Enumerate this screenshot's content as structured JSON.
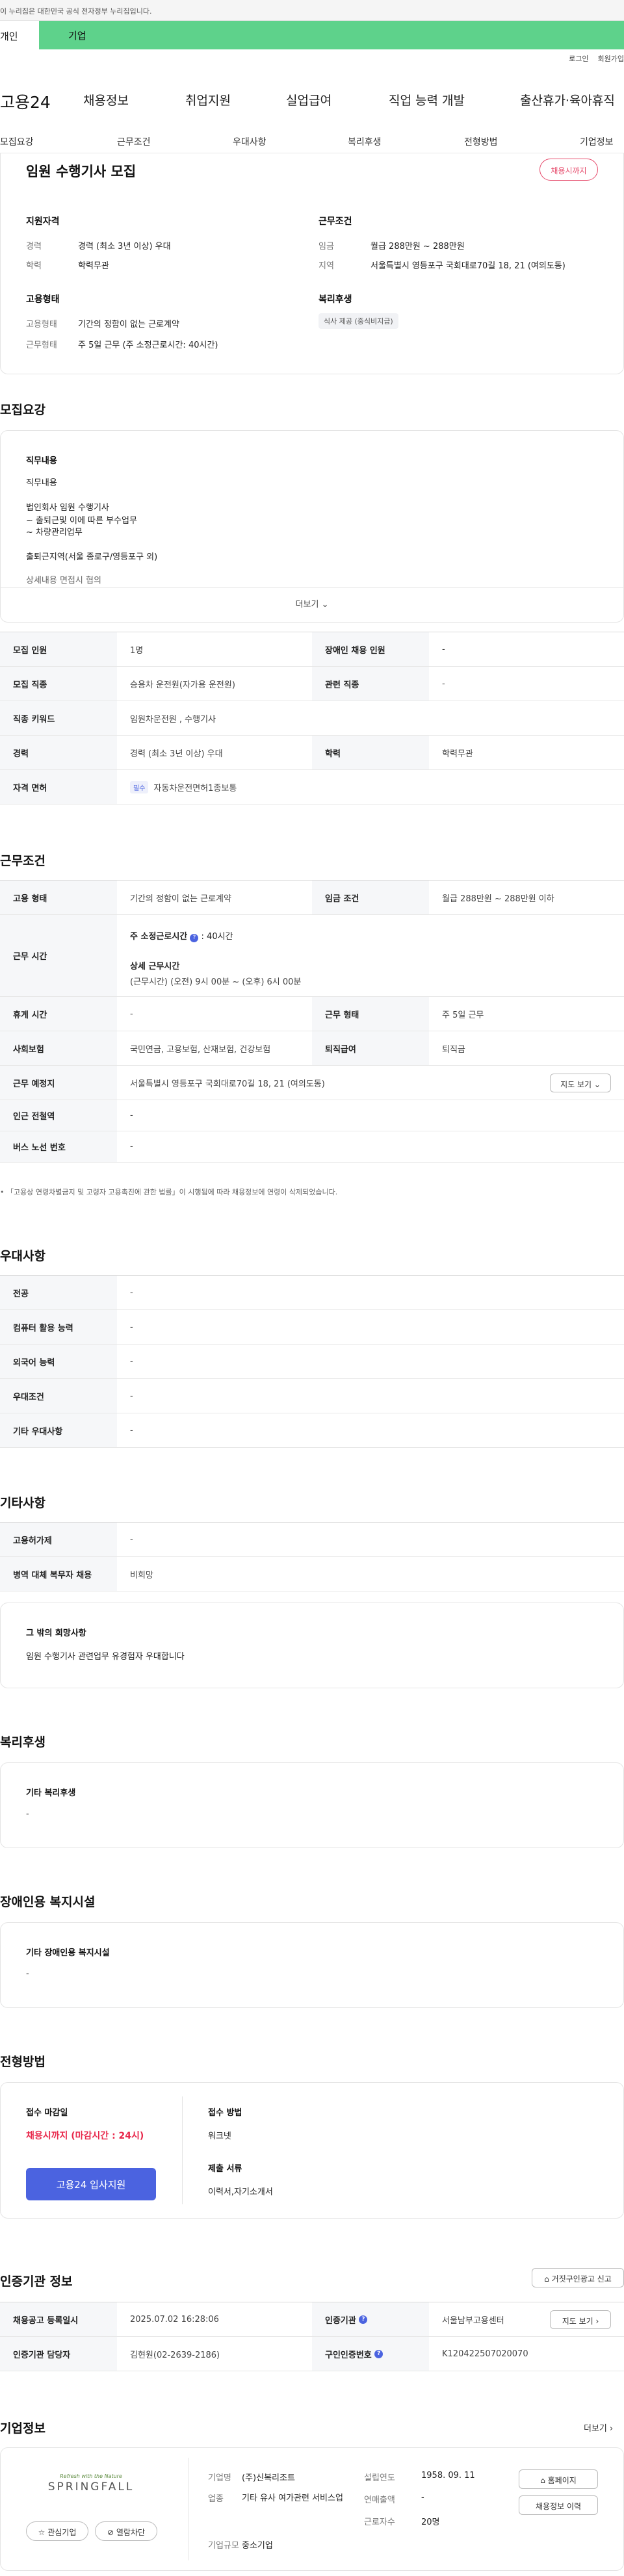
{
  "topbar": {
    "notice": "이 누리집은 대한민국 공식 전자정부 누리집입니다."
  },
  "mode": {
    "personal": "개인",
    "company": "기업"
  },
  "util": {
    "login": "로그인",
    "join": "회원가입"
  },
  "gnb": {
    "logo": "고용24",
    "items": [
      "채용정보",
      "취업지원",
      "실업급여",
      "직업 능력 개발",
      "출산휴가·육아휴직"
    ]
  },
  "subnav": [
    "모집요강",
    "근무조건",
    "우대사항",
    "복리후생",
    "전형방법",
    "기업정보"
  ],
  "job": {
    "title": "임원 수행기사 모집",
    "badge": "채용시까지"
  },
  "summary": {
    "qual_title": "지원자격",
    "career_label": "경력",
    "career_value": "경력 (최소 3년 이상) 우대",
    "edu_label": "학력",
    "edu_value": "학력무관",
    "cond_title": "근무조건",
    "wage_label": "임금",
    "wage_value": "월급 288만원 ~ 288만원",
    "loc_label": "지역",
    "loc_value": "서울특별시 영등포구 국회대로70길 18, 21 (여의도동)",
    "emp_title": "고용형태",
    "emptype_label": "고용형태",
    "emptype_value": "기간의 정함이 없는 근로계약",
    "worktype_label": "근무형태",
    "worktype_value": "주 5일 근무 (주 소정근로시간: 40시간)",
    "welfare_title": "복리후생",
    "welfare_tag": "식사 제공 (중식비지급)"
  },
  "recruit": {
    "section": "모집요강",
    "duty_title": "직무내용",
    "duty_lines": [
      "직무내용",
      "법인회사 임원 수행기사",
      "~ 출퇴근및 이에 따른 부수업무",
      "~ 차량관리업무",
      "출퇴근지역(서울 종로구/영등포구 외)",
      "상세내용 면접시 협의"
    ],
    "more": "더보기"
  },
  "recruit_table": {
    "rows": [
      {
        "l1": "모집 인원",
        "v1": "1명",
        "l2": "장애인 채용 인원",
        "v2": "-"
      },
      {
        "l1": "모집 직종",
        "v1": "승용차 운전원(자가용 운전원)",
        "l2": "관련 직종",
        "v2": "-"
      },
      {
        "l1": "직종 키워드",
        "v1": "임원차운전원 , 수행기사"
      },
      {
        "l1": "경력",
        "v1": "경력 (최소 3년 이상) 우대",
        "l2": "학력",
        "v2": "학력무관"
      },
      {
        "l1": "자격 면허",
        "tag": "필수",
        "v1": "자동차운전면허1종보통"
      }
    ]
  },
  "conditions": {
    "section": "근무조건",
    "emp_label": "고용 형태",
    "emp_value": "기간의 정함이 없는 근로계약",
    "wage_label": "임금 조건",
    "wage_value": "월급 288만원 ~ 288만원 이하",
    "time_label": "근무 시간",
    "time_main": "주 소정근로시간",
    "time_hours": "40시간",
    "time_detail_title": "상세 근무시간",
    "time_detail": "(근무시간) (오전) 9시 00분 ~ (오후) 6시 00분",
    "rest_label": "휴게 시간",
    "rest_value": "-",
    "form_label": "근무 형태",
    "form_value": "주 5일 근무",
    "ins_label": "사회보험",
    "ins_value": "국민연금, 고용보험, 산재보험, 건강보험",
    "ret_label": "퇴직급여",
    "ret_value": "퇴직금",
    "place_label": "근무 예정지",
    "place_value": "서울특별시 영등포구 국회대로70길 18, 21 (여의도동)",
    "map_btn": "지도 보기",
    "subway_label": "인근 전철역",
    "subway_value": "-",
    "bus_label": "버스 노선 번호",
    "bus_value": "-",
    "note": "「고용상 연령차별금지 및 고령자 고용촉진에 관한 법률」이 시행됨에 따라 채용정보에 연령이 삭제되었습니다."
  },
  "pref": {
    "section": "우대사항",
    "rows": [
      {
        "l": "전공",
        "v": "-"
      },
      {
        "l": "컴퓨터 활용 능력",
        "v": "-"
      },
      {
        "l": "외국어 능력",
        "v": "-"
      },
      {
        "l": "우대조건",
        "v": "-"
      },
      {
        "l": "기타 우대사항",
        "v": "-"
      }
    ]
  },
  "etc": {
    "section": "기타사항",
    "rows": [
      {
        "l": "고용허가제",
        "v": "-"
      },
      {
        "l": "병역 대체 복무자 채용",
        "v": "비희망"
      }
    ],
    "hope_title": "그 밖의 희망사항",
    "hope_value": "임원 수행기사 관련업무 유경험자 우대합니다"
  },
  "welfare": {
    "section": "복리후생",
    "title": "기타 복리후생",
    "value": "-"
  },
  "disability": {
    "section": "장애인용 복지시설",
    "title": "기타 장애인용 복지시설",
    "value": "-"
  },
  "selection": {
    "section": "전형방법",
    "deadline_title": "접수 마감일",
    "deadline_value": "채용시까지 (마감시간 : 24시)",
    "apply_btn": "고용24 입사지원",
    "method_title": "접수 방법",
    "method_value": "워크넷",
    "docs_title": "제출 서류",
    "docs_value": "이력서,자기소개서"
  },
  "cert": {
    "section": "인증기관 정보",
    "report_btn": "거짓구인광고 신고",
    "reg_label": "채용공고 등록일시",
    "reg_value": "2025.07.02 16:28:06",
    "agency_label": "인증기관",
    "agency_value": "서울남부고용센터",
    "map_btn": "지도 보기",
    "mgr_label": "인증기관 담당자",
    "mgr_value": "김현원(02-2639-2186)",
    "num_label": "구인인증번호",
    "num_value": "K120422507020070"
  },
  "company": {
    "section": "기업정보",
    "more": "더보기",
    "logo_small": "Refresh with the Nature",
    "logo_big": "SPRINGFALL",
    "fav_btn": "관심기업",
    "block_btn": "열람차단",
    "name_label": "기업명",
    "name_value": "(주)신복리조트",
    "ind_label": "업종",
    "ind_value": "기타 유사 여가관련 서비스업",
    "size_label": "기업규모",
    "size_value": "중소기업",
    "est_label": "설립연도",
    "est_value": "1958. 09. 11",
    "sales_label": "연매출액",
    "sales_value": "-",
    "emp_label": "근로자수",
    "emp_value": "20명",
    "home_btn": "홈페이지",
    "history_btn": "채용정보 이력"
  },
  "colors": {
    "accent_green": "#5ed28b",
    "brand_blue": "#4b63e0",
    "badge_red": "#e64a6b"
  }
}
